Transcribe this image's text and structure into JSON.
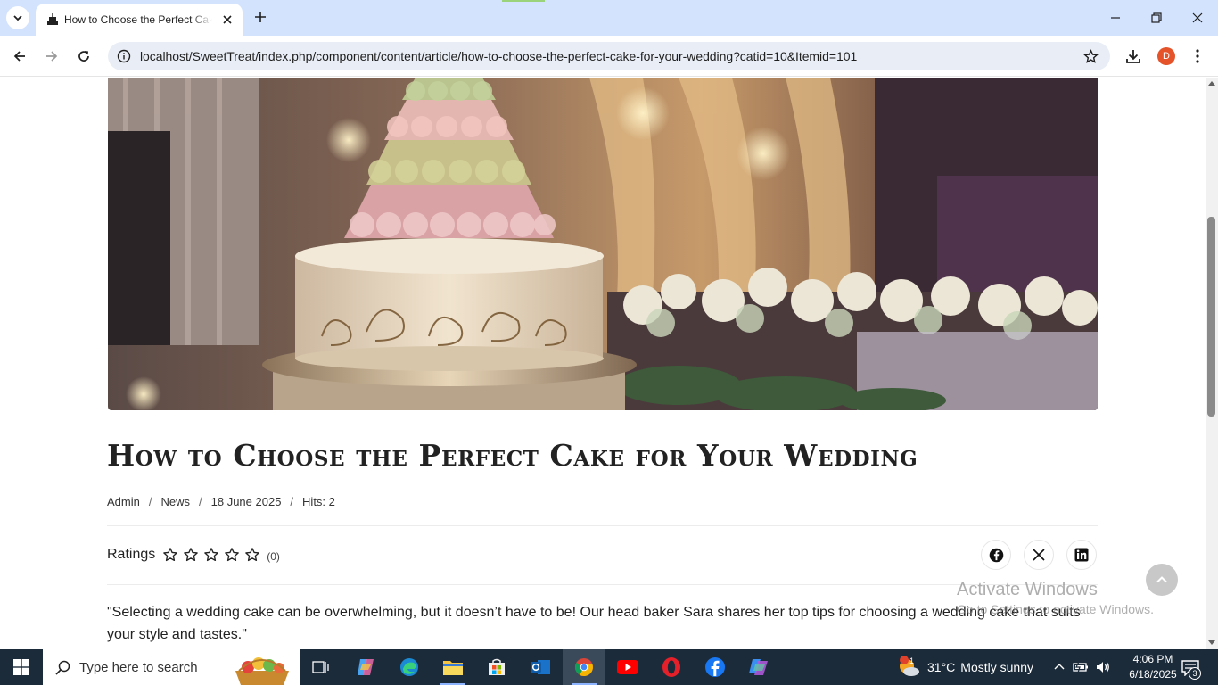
{
  "browser": {
    "tab_title": "How to Choose the Perfect Cake for Your Wedding",
    "url": "localhost/SweetTreat/index.php/component/content/article/how-to-choose-the-perfect-cake-for-your-wedding?catid=10&Itemid=101",
    "profile_initial": "D"
  },
  "article": {
    "title": "How to Choose the Perfect Cake for Your Wedding",
    "meta": {
      "author": "Admin",
      "category": "News",
      "date": "18 June 2025",
      "hits": "Hits: 2",
      "separator": "/"
    },
    "ratings": {
      "label": "Ratings",
      "count": "(0)",
      "stars_total": 5,
      "stars_filled": 0
    },
    "share": [
      "facebook",
      "x",
      "linkedin"
    ],
    "intro": "\"Selecting a wedding cake can be overwhelming, but it doesn’t have to be! Our head baker Sara shares her top tips for choosing a wedding cake that suits your style and tastes.\""
  },
  "watermark": {
    "title": "Activate Windows",
    "subtitle": "Go to Settings to activate Windows."
  },
  "taskbar": {
    "search_placeholder": "Type here to search",
    "apps": [
      "task-view",
      "copilot",
      "edge",
      "file-explorer",
      "microsoft-store",
      "outlook",
      "chrome",
      "youtube",
      "opera",
      "facebook",
      "microsoft-365"
    ],
    "weather": {
      "temp": "31°C",
      "condition": "Mostly sunny",
      "badge": "1"
    },
    "time": "4:06 PM",
    "date": "6/18/2025",
    "notifications": "3"
  },
  "colors": {
    "tabbar_bg": "#d3e3fd",
    "omnibox_bg": "#e9eef6",
    "taskbar_bg": "#1c2b3a",
    "avatar": "#e4532a"
  }
}
